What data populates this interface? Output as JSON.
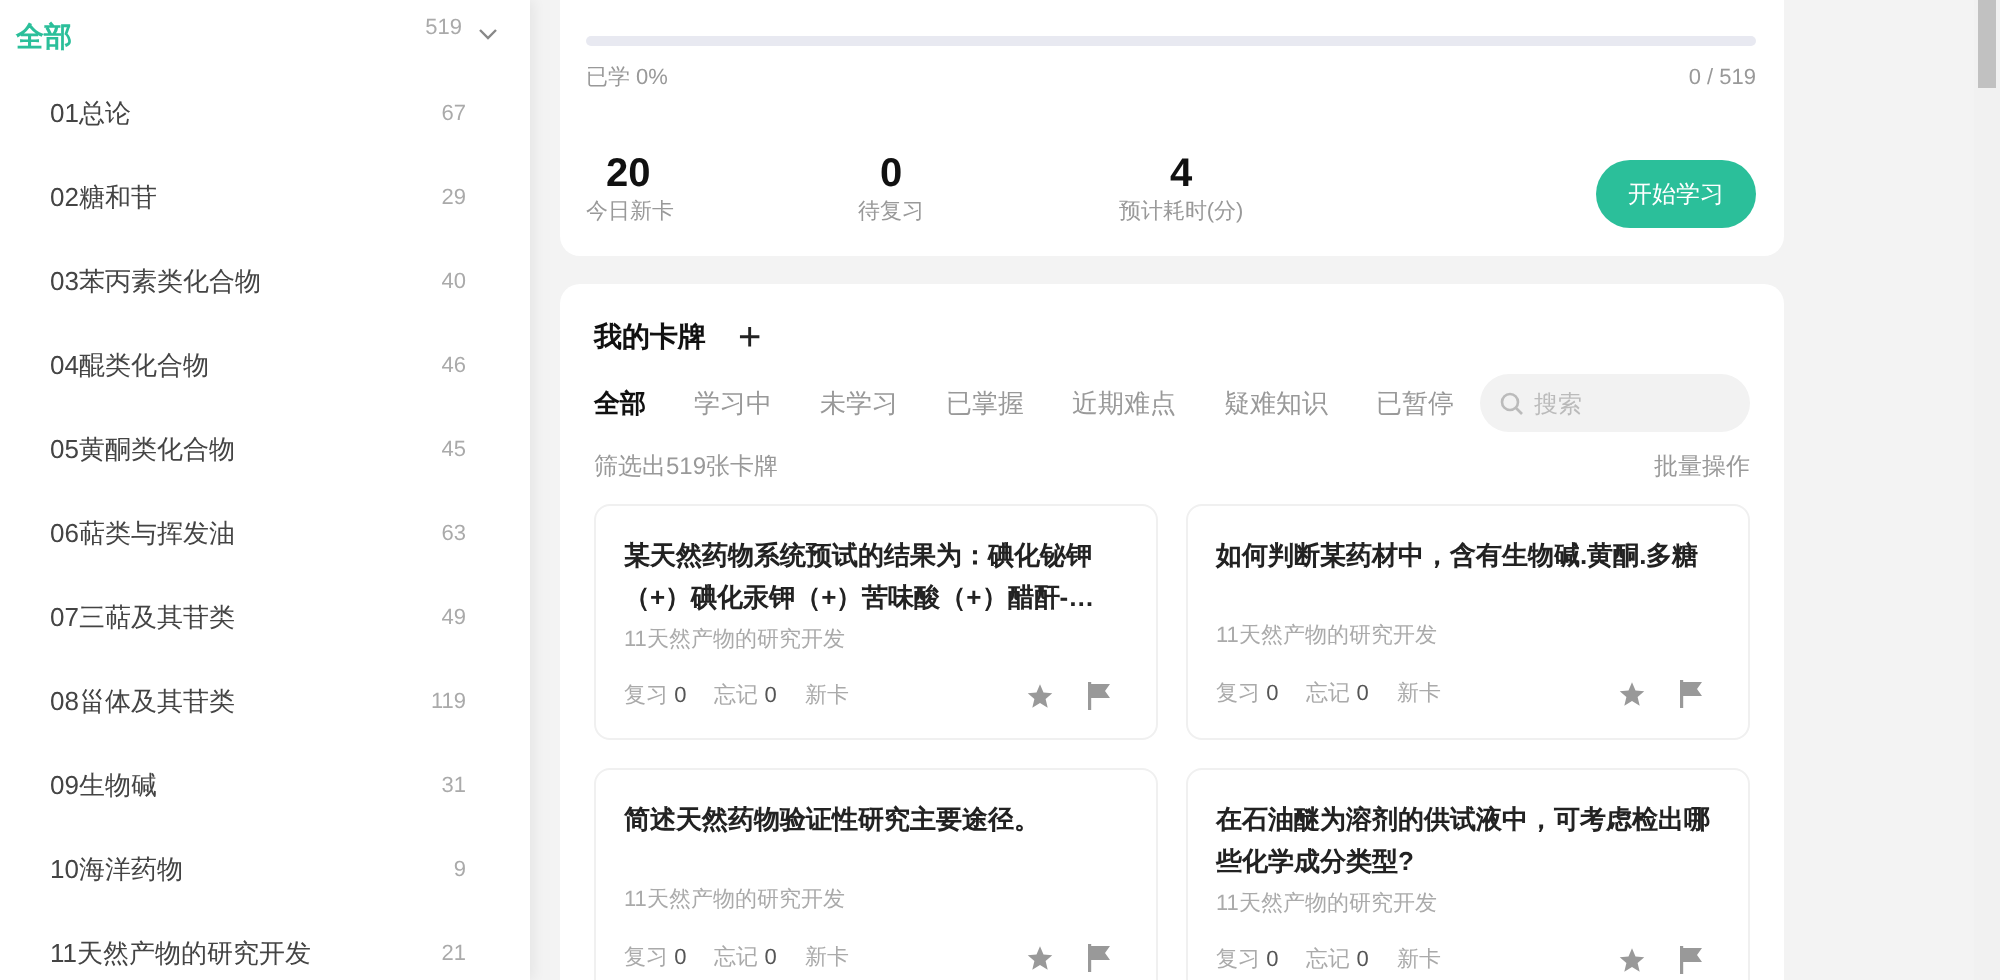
{
  "sidebar": {
    "all": {
      "label": "全部",
      "count": "519",
      "selected": true,
      "expanded": true
    },
    "items": [
      {
        "label": "01总论",
        "count": "67",
        "selected": false
      },
      {
        "label": "02糖和苷",
        "count": "29",
        "selected": false
      },
      {
        "label": "03苯丙素类化合物",
        "count": "40",
        "selected": false
      },
      {
        "label": "04醌类化合物",
        "count": "46",
        "selected": false
      },
      {
        "label": "05黄酮类化合物",
        "count": "45",
        "selected": false
      },
      {
        "label": "06萜类与挥发油",
        "count": "63",
        "selected": false
      },
      {
        "label": "07三萜及其苷类",
        "count": "49",
        "selected": false
      },
      {
        "label": "08甾体及其苷类",
        "count": "119",
        "selected": false
      },
      {
        "label": "09生物碱",
        "count": "31",
        "selected": false
      },
      {
        "label": "10海洋药物",
        "count": "9",
        "selected": false
      },
      {
        "label": "11天然产物的研究开发",
        "count": "21",
        "selected": false
      }
    ]
  },
  "progress": {
    "level": 0,
    "learned": "已学 0%",
    "ratio": "0 / 519"
  },
  "stats": [
    {
      "value": "20",
      "label": "今日新卡"
    },
    {
      "value": "0",
      "label": "待复习"
    },
    {
      "value": "4",
      "label": "预计耗时(分)"
    }
  ],
  "start_button": "开始学习",
  "deck": {
    "title": "我的卡牌",
    "add": "+",
    "tabs": [
      {
        "label": "全部",
        "selected": true
      },
      {
        "label": "学习中",
        "selected": false
      },
      {
        "label": "未学习",
        "selected": false
      },
      {
        "label": "已掌握",
        "selected": false
      },
      {
        "label": "近期难点",
        "selected": false
      },
      {
        "label": "疑难知识",
        "selected": false
      },
      {
        "label": "已暂停",
        "selected": false
      }
    ],
    "search": {
      "placeholder": "搜索"
    },
    "filter_text": "筛选出519张卡牌",
    "batch": "批量操作",
    "cards": [
      {
        "title": "某天然药物系统预试的结果为：碘化铋钾（+）碘化汞钾（+）苦味酸（+）醋酐-…",
        "category": "11天然产物的研究开发",
        "review_label": "复习",
        "review": "0",
        "forget_label": "忘记",
        "forget": "0",
        "status": "新卡"
      },
      {
        "title": "如何判断某药材中，含有生物碱.黄酮.多糖",
        "category": "11天然产物的研究开发",
        "review_label": "复习",
        "review": "0",
        "forget_label": "忘记",
        "forget": "0",
        "status": "新卡"
      },
      {
        "title": "简述天然药物验证性研究主要途径。",
        "category": "11天然产物的研究开发",
        "review_label": "复习",
        "review": "0",
        "forget_label": "忘记",
        "forget": "0",
        "status": "新卡"
      },
      {
        "title": "在石油醚为溶剂的供试液中，可考虑检出哪些化学成分类型?",
        "category": "11天然产物的研究开发",
        "review_label": "复习",
        "review": "0",
        "forget_label": "忘记",
        "forget": "0",
        "status": "新卡"
      }
    ]
  }
}
